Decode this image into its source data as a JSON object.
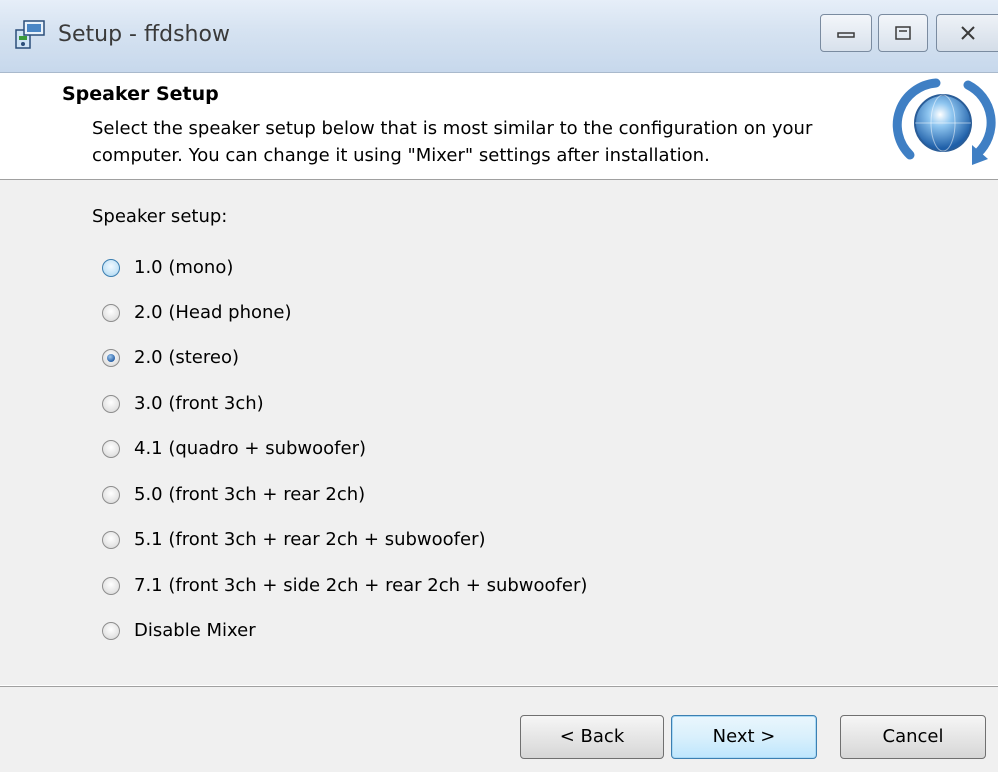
{
  "window": {
    "title": "Setup - ffdshow"
  },
  "header": {
    "title": "Speaker Setup",
    "description": "Select the speaker setup below that is most similar to the configuration on your computer. You can change it using \"Mixer\" settings after installation."
  },
  "speaker_setup": {
    "label": "Speaker setup:",
    "selected_index": 2,
    "options": [
      "1.0 (mono)",
      "2.0 (Head phone)",
      "2.0 (stereo)",
      "3.0 (front 3ch)",
      "4.1 (quadro + subwoofer)",
      "5.0 (front 3ch + rear 2ch)",
      "5.1 (front 3ch + rear 2ch + subwoofer)",
      "7.1 (front 3ch + side 2ch + rear 2ch + subwoofer)",
      "Disable Mixer"
    ]
  },
  "buttons": {
    "back": "< Back",
    "next": "Next >",
    "cancel": "Cancel"
  },
  "icons": {
    "app": "setup-installer-icon",
    "logo": "ffdshow-globe-logo-icon"
  }
}
